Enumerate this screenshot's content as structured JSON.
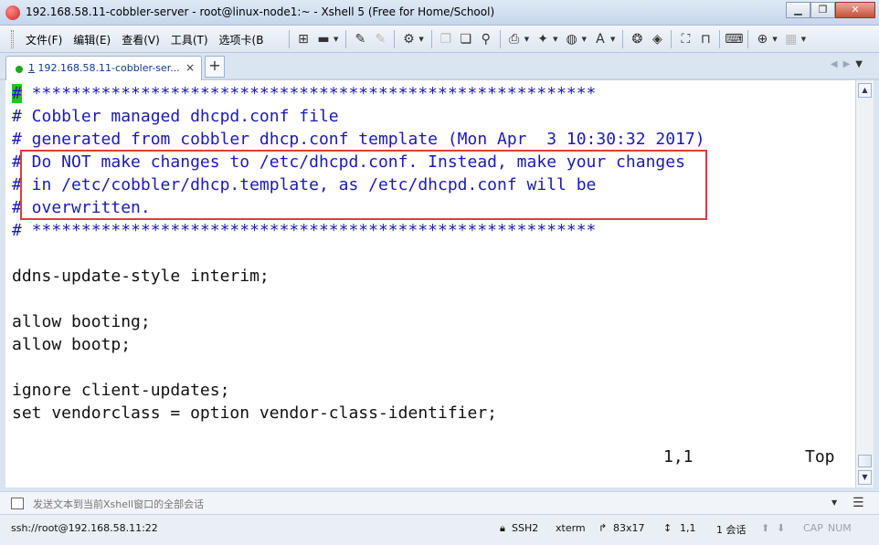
{
  "window": {
    "title": "192.168.58.11-cobbler-server - root@linux-node1:~ - Xshell 5 (Free for Home/School)",
    "min_glyph": "▁",
    "restore_glyph": "❐",
    "close_glyph": "✕"
  },
  "menu": [
    "文件(F)",
    "编辑(E)",
    "查看(V)",
    "工具(T)",
    "选项卡(B"
  ],
  "toolbar_icons": [
    "new-session-icon",
    "open-folder-icon",
    "reconnect-icon",
    "disconnect-icon",
    "properties-icon",
    "copy-icon",
    "paste-icon",
    "find-icon",
    "print-icon",
    "transfer-icon",
    "globe-icon",
    "font-icon",
    "xftp-icon",
    "xagent-icon",
    "fullscreen-icon",
    "lock-icon",
    "keyboard-icon",
    "add-tab-icon",
    "layout-icon"
  ],
  "tab": {
    "number": "1",
    "label": " 192.168.58.11-cobbler-ser...",
    "close": "×",
    "add": "+",
    "status_color": "#1fa51f"
  },
  "terminal": {
    "lines": [
      {
        "text": "#",
        "rest": " *********************************************************",
        "kind": "comment-cursor"
      },
      {
        "text": "# Cobbler managed dhcpd.conf file",
        "kind": "comment"
      },
      {
        "text": "# generated from cobbler dhcp.conf template (Mon Apr  3 10:30:32 2017)",
        "kind": "comment"
      },
      {
        "text": "# Do NOT make changes to /etc/dhcpd.conf. Instead, make your changes",
        "kind": "comment"
      },
      {
        "text": "# in /etc/cobbler/dhcp.template, as /etc/dhcpd.conf will be",
        "kind": "comment"
      },
      {
        "text": "# overwritten.",
        "kind": "comment"
      },
      {
        "text": "# *********************************************************",
        "kind": "comment"
      },
      {
        "text": "",
        "kind": "plain"
      },
      {
        "text": "ddns-update-style interim;",
        "kind": "plain"
      },
      {
        "text": "",
        "kind": "plain"
      },
      {
        "text": "allow booting;",
        "kind": "plain"
      },
      {
        "text": "allow bootp;",
        "kind": "plain"
      },
      {
        "text": "",
        "kind": "plain"
      },
      {
        "text": "ignore client-updates;",
        "kind": "plain"
      },
      {
        "text": "set vendorclass = option vendor-class-identifier;",
        "kind": "plain"
      }
    ],
    "ruler": "1,1",
    "position": "Top",
    "comment_color": "#1a1ab8",
    "cursor_color": "#22c322",
    "highlight_color": "#e23a3a"
  },
  "compose": {
    "placeholder": "发送文本到当前Xshell窗口的全部会话"
  },
  "status": {
    "connection": "ssh://root@192.168.58.11:22",
    "protocol": "SSH2",
    "terminal_type": "xterm",
    "size": "83x17",
    "cursor": "1,1",
    "sessions": "1 会话",
    "caps": "CAP",
    "num": "NUM"
  }
}
